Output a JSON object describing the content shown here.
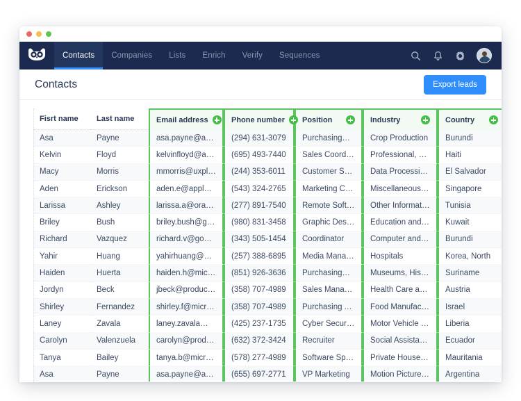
{
  "window": {
    "traffic_lights": [
      "close",
      "minimize",
      "zoom"
    ]
  },
  "navbar": {
    "logo_name": "owl-logo",
    "items": [
      {
        "label": "Contacts",
        "active": true
      },
      {
        "label": "Companies",
        "active": false
      },
      {
        "label": "Lists",
        "active": false
      },
      {
        "label": "Enrich",
        "active": false
      },
      {
        "label": "Verify",
        "active": false
      },
      {
        "label": "Sequences",
        "active": false
      }
    ],
    "icons": [
      "search-icon",
      "bell-icon",
      "gear-icon"
    ],
    "avatar": "user-avatar"
  },
  "page": {
    "title": "Contacts",
    "export_label": "Export leads",
    "accent_blue": "#2f8efb",
    "accent_green": "#45bd4a",
    "navy": "#1b2a4e"
  },
  "table": {
    "columns": [
      {
        "key": "first_name",
        "label": "Fisrt name",
        "locked": false,
        "has_plus": false
      },
      {
        "key": "last_name",
        "label": "Last name",
        "locked": false,
        "has_plus": false
      },
      {
        "key": "email",
        "label": "Email address",
        "locked": true,
        "has_plus": true
      },
      {
        "key": "phone",
        "label": "Phone number",
        "locked": true,
        "has_plus": true
      },
      {
        "key": "position",
        "label": "Position",
        "locked": true,
        "has_plus": true
      },
      {
        "key": "industry",
        "label": "Industry",
        "locked": true,
        "has_plus": true
      },
      {
        "key": "country",
        "label": "Country",
        "locked": true,
        "has_plus": true
      }
    ],
    "rows": [
      {
        "first_name": "Asa",
        "last_name": "Payne",
        "email": "asa.payne@am…",
        "phone": "(294) 631-3079",
        "position": "Purchasing…",
        "industry": "Crop Production",
        "country": "Burundi"
      },
      {
        "first_name": "Kelvin",
        "last_name": "Floyd",
        "email": "kelvinfloyd@ap…",
        "phone": "(695) 493-7440",
        "position": "Sales Coordi…",
        "industry": "Professional, Sc…",
        "country": "Haiti"
      },
      {
        "first_name": "Macy",
        "last_name": "Morris",
        "email": "mmorris@uxpla…",
        "phone": "(244) 353-6011",
        "position": "Customer Se…",
        "industry": "Data Processin…",
        "country": "El Salvador"
      },
      {
        "first_name": "Aden",
        "last_name": "Erickson",
        "email": "aden.e@apple.…",
        "phone": "(543) 324-2765",
        "position": "Marketing C…",
        "industry": "Miscellaneous…",
        "country": "Singapore"
      },
      {
        "first_name": "Larissa",
        "last_name": "Ashley",
        "email": "larissa.a@oracl…",
        "phone": "(277) 891-7540",
        "position": "Remote Soft…",
        "industry": "Other Informati…",
        "country": "Tunisia"
      },
      {
        "first_name": "Briley",
        "last_name": "Bush",
        "email": "briley.bush@go…",
        "phone": "(980) 831-3458",
        "position": "Graphic Desi…",
        "industry": "Education and…",
        "country": "Kuwait"
      },
      {
        "first_name": "Richard",
        "last_name": "Vazquez",
        "email": "richard.v@goo…",
        "phone": "(343) 505-1454",
        "position": "Coordinator",
        "industry": "Computer and…",
        "country": "Burundi"
      },
      {
        "first_name": "Yahir",
        "last_name": "Huang",
        "email": "yahirhuang@ux…",
        "phone": "(257) 388-6895",
        "position": "Media Mana…",
        "industry": "Hospitals",
        "country": "Korea, North"
      },
      {
        "first_name": "Haiden",
        "last_name": "Huerta",
        "email": "haiden.h@micr…",
        "phone": "(851) 926-3636",
        "position": "Purchasing…",
        "industry": "Museums, Hist…",
        "country": "Suriname"
      },
      {
        "first_name": "Jordyn",
        "last_name": "Beck",
        "email": "jbeck@product…",
        "phone": "(358) 707-4989",
        "position": "Sales Manager",
        "industry": "Health Care an…",
        "country": "Austria"
      },
      {
        "first_name": "Shirley",
        "last_name": "Fernandez",
        "email": "shirley.f@micro…",
        "phone": "(358) 707-4989",
        "position": "Purchasing A…",
        "industry": "Food Manufact…",
        "country": "Israel"
      },
      {
        "first_name": "Laney",
        "last_name": "Zavala",
        "email": "laney.zavala@p…",
        "phone": "(425) 237-1735",
        "position": "Cyber Securi…",
        "industry": "Motor Vehicle a…",
        "country": "Liberia"
      },
      {
        "first_name": "Carolyn",
        "last_name": "Valenzuela",
        "email": "carolyn@produ…",
        "phone": "(632) 372-3424",
        "position": "Recruiter",
        "industry": "Social Assistance",
        "country": "Ecuador"
      },
      {
        "first_name": "Tanya",
        "last_name": "Bailey",
        "email": "tanya.b@micro…",
        "phone": "(578) 277-4989",
        "position": "Software Sp…",
        "industry": "Private Househ…",
        "country": "Mauritania"
      },
      {
        "first_name": "Asa",
        "last_name": "Payne",
        "email": "asa.payne@am…",
        "phone": "(655) 697-2771",
        "position": "VP Marketing",
        "industry": "Motion Picture…",
        "country": "Argentina"
      }
    ]
  }
}
